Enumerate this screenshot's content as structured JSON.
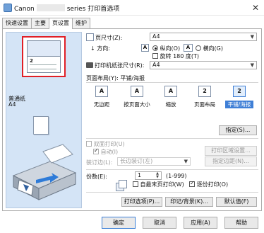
{
  "window": {
    "title_prefix": "Canon",
    "title_suffix": "series 打印首选项",
    "close": "✕"
  },
  "tabs": [
    {
      "label": "快速设置",
      "active": false
    },
    {
      "label": "主要",
      "active": false
    },
    {
      "label": "页设置",
      "active": true
    },
    {
      "label": "维护",
      "active": false
    }
  ],
  "preview": {
    "page_number": "2",
    "media_type": "普通纸",
    "media_size": "A4"
  },
  "page_setup": {
    "page_size_label": "页尺寸(Z):",
    "page_size_value": "A4",
    "orientation_label": "方向:",
    "portrait_label": "纵向(O)",
    "landscape_label": "横向(G)",
    "rotate_label": "旋转 180 度(T)",
    "printer_paper_label": "打印机纸张尺寸(R):",
    "printer_paper_value": "A4",
    "page_layout_label": "页面布局(Y): 平铺/海报",
    "layouts": [
      {
        "label": "无边距",
        "glyph": "A",
        "selected": false
      },
      {
        "label": "按页面大小",
        "glyph": "A",
        "selected": false
      },
      {
        "label": "缩放",
        "glyph": "A",
        "selected": false
      },
      {
        "label": "页面布局",
        "glyph": "2",
        "selected": false
      },
      {
        "label": "平铺/海报",
        "glyph": "2",
        "selected": true
      }
    ],
    "specify_button": "指定(S)..."
  },
  "duplex": {
    "duplex_label": "双面打印(U)",
    "auto_label": "自动(I)",
    "print_area_button": "打印区域设置...",
    "stapling_label": "装订边(L):",
    "stapling_value": "长边装订(左)",
    "margin_button": "指定边距(N)..."
  },
  "copies": {
    "label": "份数(E):",
    "value": "1",
    "range": "(1-999)",
    "collate_label": "自最末页打印(W)",
    "collate2_label": "逐份打印(O)"
  },
  "buttons": {
    "print_options": "打印选项(P)...",
    "stamp": "印记/背景(K)...",
    "defaults": "默认值(F)",
    "ok": "确定",
    "cancel": "取消",
    "apply": "应用(A)",
    "help": "帮助"
  }
}
